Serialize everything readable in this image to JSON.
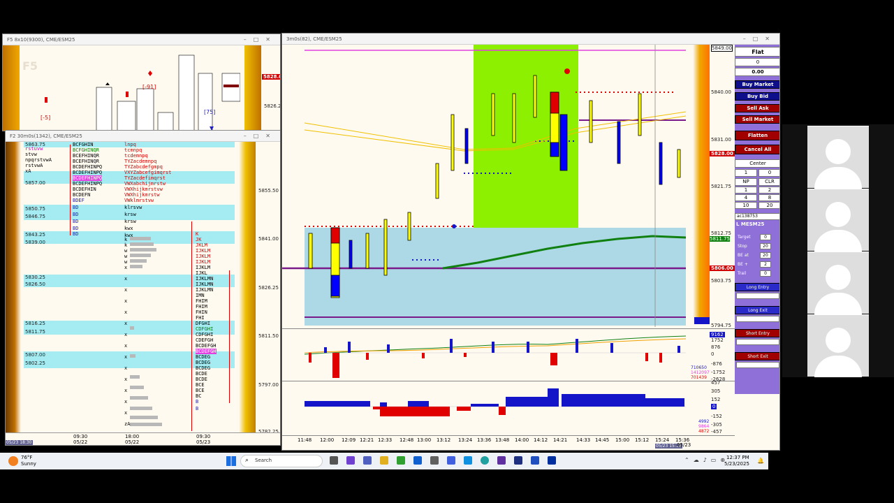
{
  "window_top_left": {
    "title": "F5 8x10(9300), CME/ESM25",
    "watermark": "F5",
    "price_label": "5828.00",
    "price_axis": [
      "5826.25"
    ]
  },
  "window_bottom_left": {
    "title": "F2 30m0s(1342), CME/ESM25",
    "price_axis": [
      "5855.50",
      "5841.00",
      "5826.25",
      "5811.50",
      "5797.00",
      "5782.25"
    ],
    "band_prices": [
      "5863.75",
      "5857.00",
      "5850.75",
      "5846.75",
      "5843.25",
      "5839.00",
      "5830.25",
      "5826.50",
      "5816.25",
      "5811.75",
      "5807.00",
      "5802.25"
    ],
    "time_axis": [
      "05/23 18:30",
      "09:30",
      "05/22",
      "18:00",
      "05/22",
      "09:30",
      "05/23"
    ],
    "tpo_rows_a": [
      "BCFGHIN",
      "BCFGHINQR",
      "BCEFHINQR",
      "BCEFHINQR",
      "BCDEFHINPQ",
      "BCDEFHINPQ",
      "BCDEFHINPQ",
      "BCDEFHINPQ",
      "BCDEFHIN",
      "BCDEFN",
      "BDEF",
      "BD",
      "BD",
      "BD",
      "BD",
      "BD"
    ],
    "tpo_rows_b": [
      "lnpq",
      "tcmnpq",
      "tcdemnpq",
      "TYZacdemnpq",
      "TYZabcdefgmpq",
      "VXYZabcefgimqrst",
      "TYZacdefimqrst",
      "VWXabchijmrstw",
      "VWXhijkmrstvw",
      "VWXhijkmrstw",
      "VWklmrstvw",
      "klrsvw",
      "krsw",
      "krsw",
      "kwx",
      "kwx"
    ],
    "tpo_rows_c": [
      "K",
      "JK",
      "JKLM",
      "IJKLM",
      "IJKLM",
      "IJKLM",
      "IJKLM",
      "IJKL",
      "IJKLMN",
      "IJKLMN",
      "IJKLMN",
      "IMN",
      "FHIM",
      "FHIM",
      "FHIN",
      "FHI",
      "DFGHI",
      "CDFGHI",
      "CDFGHI",
      "CDEFGH",
      "BCDEFGH",
      "BCDEFGH",
      "BCDEG",
      "BCDEG",
      "BCDEG",
      "BCDE",
      "BCDE",
      "BCE",
      "BCE",
      "BC",
      "B",
      "B"
    ],
    "tpo_left": [
      "rstuvw",
      "stvw",
      "npqrstvwA",
      "rstvwA",
      "xA"
    ]
  },
  "window_main": {
    "title": "3m0s(82), CME/ESM25",
    "price_axis": [
      "5849.00",
      "5840.00",
      "5831.00",
      "5828.00",
      "5821.75",
      "5812.75",
      "5811.75",
      "5806.00",
      "5803.75",
      "5794.75"
    ],
    "ind1_axis": [
      "9162",
      "1752",
      "876",
      "0",
      "-876",
      "-1752",
      "-2628"
    ],
    "ind1_values": [
      "710650",
      "1412097",
      "701439"
    ],
    "ind2_axis": [
      "457",
      "305",
      "152",
      "0",
      "-152",
      "-305",
      "-457"
    ],
    "ind2_values": [
      "4992",
      "9864",
      "4872"
    ],
    "time_axis": [
      "11:48",
      "12:00",
      "12:09",
      "12:21",
      "12:33",
      "12:48",
      "13:00",
      "13:12",
      "13:24",
      "13:36",
      "13:48",
      "14:00",
      "14:12",
      "14:21",
      "14:33",
      "14:45",
      "15:00",
      "15:12",
      "15:24",
      "15:36"
    ],
    "time_sub": [
      "05/23 15:16",
      "05/23"
    ]
  },
  "panel": {
    "position": "Flat",
    "qty": "0",
    "pnl": "0.00",
    "buy_market": "Buy Market",
    "buy_bid": "Buy Bid",
    "sell_ask": "Sell Ask",
    "sell_market": "Sell Market",
    "flatten": "Flatten",
    "cancel_all": "Cancel All",
    "center": "Center",
    "qty_fields": [
      "1",
      "0"
    ],
    "np": "NP",
    "clr": "CLR",
    "grid": [
      "1",
      "2",
      "4",
      "8",
      "10",
      "20"
    ],
    "account": "ac138753",
    "instrument": "L MESM25",
    "target_label": "Target",
    "target": "0",
    "stop_label": "Stop",
    "stop": "20",
    "beat_label": "BE at",
    "beat": "20",
    "beplus_label": "BE +",
    "beplus": "2",
    "trail_label": "Trail",
    "trail": "0",
    "long_entry": "Long Entry",
    "long_exit": "Long Exit",
    "short_entry": "Short Entry",
    "short_exit": "Short Exit"
  },
  "taskbar": {
    "temp": "76°F",
    "weather": "Sunny",
    "search": "Search",
    "time": "12:37 PM",
    "date": "5/23/2025"
  },
  "colors": {
    "accent": "#8cf000",
    "panel": "#8f6fd8",
    "candle_up": "#ffff00",
    "candle_down": "#0000ff",
    "sell": "#e00000"
  }
}
